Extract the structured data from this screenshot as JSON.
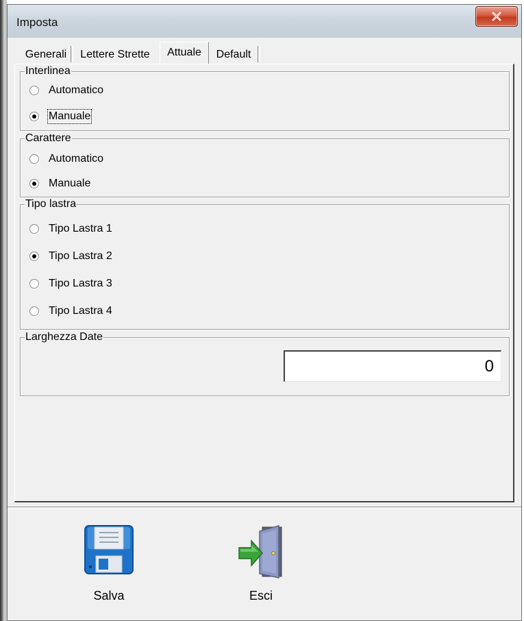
{
  "window": {
    "title": "Imposta"
  },
  "tabs": [
    {
      "label": "Generali"
    },
    {
      "label": "Lettere Strette"
    },
    {
      "label": "Attuale",
      "active": true
    },
    {
      "label": "Default"
    }
  ],
  "groups": {
    "interlinea": {
      "title": "Interlinea",
      "options": [
        {
          "label": "Automatico",
          "checked": false
        },
        {
          "label": "Manuale",
          "checked": true
        }
      ]
    },
    "carattere": {
      "title": "Carattere",
      "options": [
        {
          "label": "Automatico",
          "checked": false
        },
        {
          "label": "Manuale",
          "checked": true
        }
      ]
    },
    "tipo_lastra": {
      "title": "Tipo lastra",
      "options": [
        {
          "label": "Tipo Lastra 1",
          "checked": false
        },
        {
          "label": "Tipo Lastra 2",
          "checked": true
        },
        {
          "label": "Tipo Lastra 3",
          "checked": false
        },
        {
          "label": "Tipo Lastra 4",
          "checked": false
        }
      ]
    },
    "larghezza_date": {
      "title": "Larghezza Date",
      "value": "0"
    }
  },
  "actions": {
    "save": {
      "label": "Salva",
      "icon": "floppy-disk-icon"
    },
    "exit": {
      "label": "Esci",
      "icon": "exit-door-icon"
    }
  },
  "colors": {
    "dialog_bg": "#f0f0f0",
    "close_button": "#c9452b",
    "floppy_blue": "#1e73c8",
    "exit_arrow_green": "#3aa43a"
  }
}
